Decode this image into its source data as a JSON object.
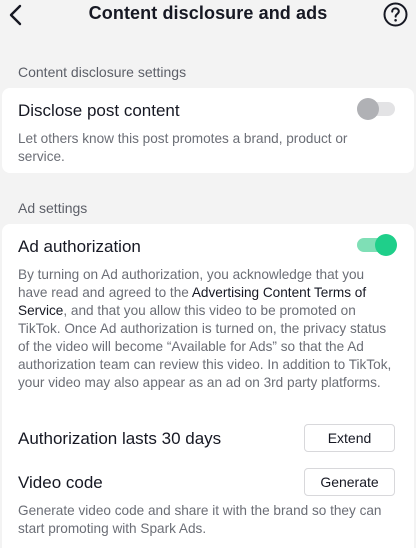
{
  "header": {
    "title": "Content disclosure and ads",
    "back_icon": "chevron-left-icon",
    "help_icon": "question-circle-icon"
  },
  "disclosure_section": {
    "header": "Content disclosure settings",
    "disclose": {
      "title": "Disclose post content",
      "description": "Let others know this post promotes a brand, product or service.",
      "enabled": false
    }
  },
  "ad_section": {
    "header": "Ad settings",
    "ad_authorization": {
      "title": "Ad authorization",
      "enabled": true,
      "description_part1": "By turning on Ad authorization, you acknowledge that you have read and agreed to the ",
      "terms_link": "Advertising Content Terms of Service",
      "description_part2": ", and that you allow this video to be promoted on TikTok. Once Ad authorization is turned on, the privacy status of the video will become “Available for Ads” so that the Ad authorization team can review this video. In addition to TikTok, your video may also appear as an ad on 3rd party platforms."
    },
    "authorization_duration": {
      "title": "Authorization lasts 30 days",
      "button_label": "Extend"
    },
    "video_code": {
      "title": "Video code",
      "button_label": "Generate",
      "description": "Generate video code and share it with the brand so they can start promoting with Spark Ads."
    }
  },
  "colors": {
    "toggle_on": "#1fcf8a",
    "toggle_off": "#b0b1b5",
    "background": "#f3f3f3"
  }
}
